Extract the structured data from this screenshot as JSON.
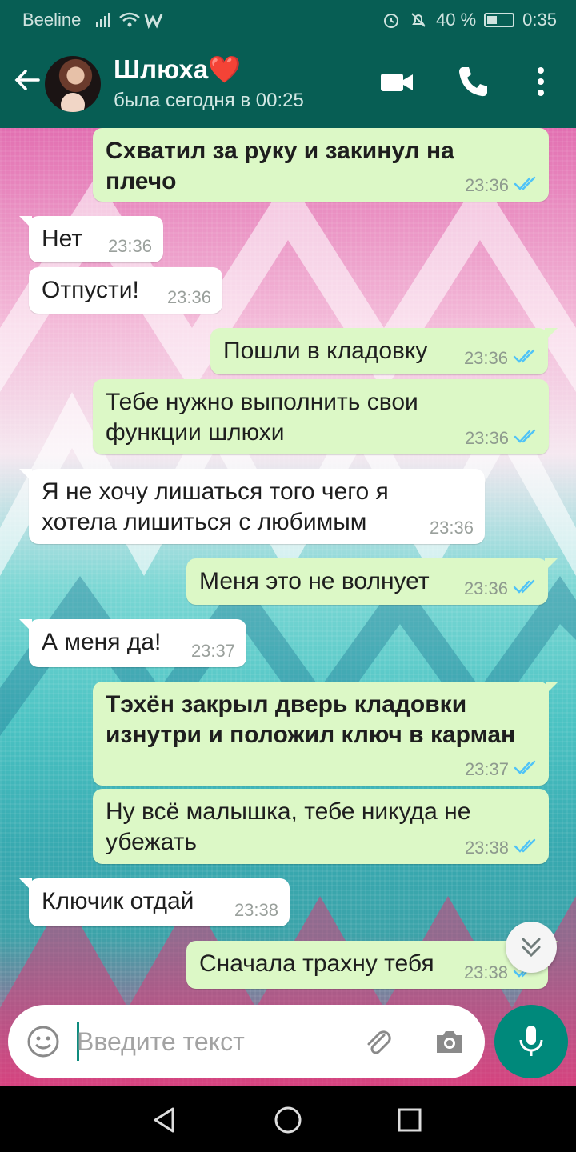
{
  "status_bar": {
    "carrier": "Beeline",
    "battery": "40 %",
    "battery_level": 0.4,
    "time": "0:35"
  },
  "header": {
    "name": "Шлюха",
    "name_emoji": "❤️",
    "status": "была сегодня в 00:25",
    "icons": [
      "back-arrow-icon",
      "video-call-icon",
      "phone-call-icon",
      "more-vert-icon"
    ]
  },
  "messages": [
    {
      "dir": "out",
      "bold": true,
      "text": "Схватил за руку и закинул на\nплечо",
      "time": "23:36",
      "read": true
    },
    {
      "dir": "in",
      "bold": false,
      "text": "Нет",
      "time": "23:36"
    },
    {
      "dir": "in",
      "bold": false,
      "text": "Отпусти!",
      "time": "23:36"
    },
    {
      "dir": "out",
      "bold": false,
      "text": "Пошли в кладовку",
      "time": "23:36",
      "read": true
    },
    {
      "dir": "out",
      "bold": false,
      "text": "Тебе нужно выполнить свои\nфункции шлюхи",
      "time": "23:36",
      "read": true
    },
    {
      "dir": "in",
      "bold": false,
      "text": "Я не хочу лишаться того чего я\nхотела лишиться с любимым",
      "time": "23:36"
    },
    {
      "dir": "out",
      "bold": false,
      "text": "Меня это не волнует",
      "time": "23:36",
      "read": true
    },
    {
      "dir": "in",
      "bold": false,
      "text": "А меня да!",
      "time": "23:37"
    },
    {
      "dir": "out",
      "bold": true,
      "text": "Тэхён закрыл дверь кладовки\nизнутри и положил ключ в карман",
      "time": "23:37",
      "read": true
    },
    {
      "dir": "out",
      "bold": false,
      "text": "Ну всё малышка, тебе никуда не\nубежать",
      "time": "23:38",
      "read": true
    },
    {
      "dir": "in",
      "bold": false,
      "text": "Ключик отдай",
      "time": "23:38"
    },
    {
      "dir": "out",
      "bold": false,
      "text": "Сначала трахну тебя",
      "time": "23:38",
      "read": true
    }
  ],
  "input": {
    "placeholder": "Введите текст"
  },
  "colors": {
    "header": "#075e54",
    "outgoing": "#dcf8c6",
    "incoming": "#ffffff",
    "accent": "#00897b",
    "read_ticks": "#4fc3f7"
  }
}
